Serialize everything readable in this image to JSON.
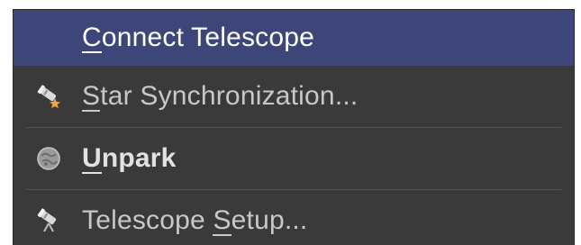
{
  "menu": {
    "items": [
      {
        "pre": "",
        "mnemonic": "C",
        "post": "onnect Telescope",
        "icon": "none"
      },
      {
        "pre": "",
        "mnemonic": "S",
        "post": "tar Synchronization...",
        "icon": "telescope-star-icon"
      },
      {
        "pre": "",
        "mnemonic": "U",
        "post": "npark",
        "icon": "park-globe-icon"
      },
      {
        "pre": "Telescope ",
        "mnemonic": "S",
        "post": "etup...",
        "icon": "telescope-setup-icon"
      }
    ]
  },
  "colors": {
    "menu_background": "#3a3a3a",
    "highlight": "#3e4679",
    "text": "#c8c8c8",
    "separator": "#525252",
    "star_accent": "#f2a33a"
  }
}
